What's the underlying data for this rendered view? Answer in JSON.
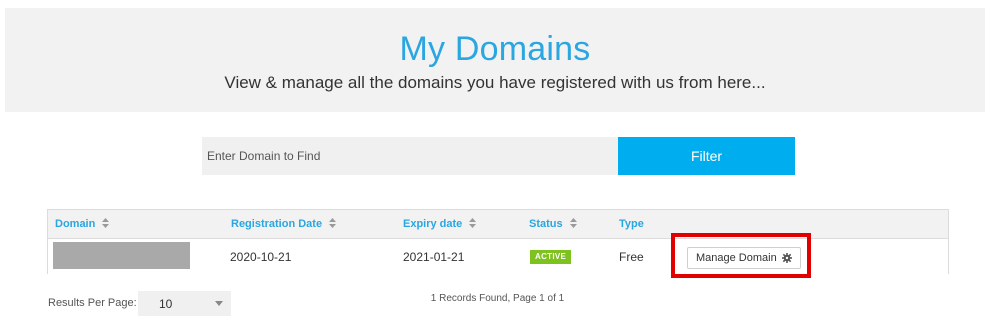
{
  "header": {
    "title": "My Domains",
    "subtitle": "View & manage all the domains you have registered with us from here..."
  },
  "filter": {
    "placeholder": "Enter Domain to Find",
    "button_label": "Filter"
  },
  "table": {
    "columns": {
      "domain": "Domain",
      "registration_date": "Registration Date",
      "expiry_date": "Expiry date",
      "status": "Status",
      "type": "Type"
    },
    "rows": [
      {
        "domain": "",
        "registration_date": "2020-10-21",
        "expiry_date": "2021-01-21",
        "status": "ACTIVE",
        "type": "Free",
        "action_label": "Manage Domain"
      }
    ]
  },
  "footer": {
    "results_per_page_label": "Results Per Page:",
    "results_per_page_value": "10",
    "records_info": "1 Records Found, Page 1 of 1"
  },
  "colors": {
    "accent_blue": "#2aa6e0",
    "filter_button": "#00aeef",
    "status_active": "#7dc21e",
    "highlight_red": "#e00000"
  },
  "icons": {
    "sort": "sort-icon",
    "gear": "gear-icon",
    "dropdown": "chevron-down-icon"
  }
}
